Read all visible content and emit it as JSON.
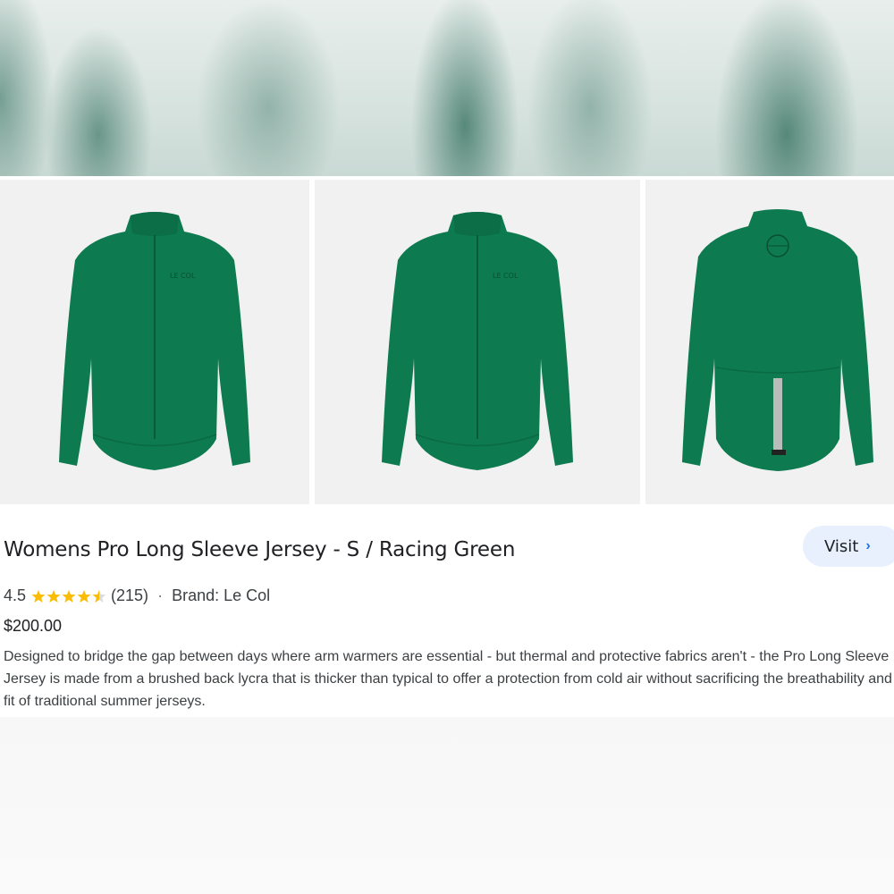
{
  "product": {
    "title": "Womens Pro Long Sleeve Jersey - S / Racing Green",
    "visit_label": "Visit",
    "rating": "4.5",
    "rating_value": 4.5,
    "review_count": "(215)",
    "brand": "Brand: Le Col",
    "price": "$200.00",
    "description": "Designed to bridge the gap between days where arm warmers are essential - but thermal and protective fabrics aren't - the Pro Long Sleeve Jersey is made from a brushed back lycra that is thicker than typical to offer a protection from cold air without sacrificing the breathability and fit of traditional summer jerseys.",
    "jersey_color": "#0d7a4f",
    "accent": "#1a73e8",
    "star_color": "#fbbc04"
  },
  "images": [
    {
      "icon": "jersey-front-icon"
    },
    {
      "icon": "jersey-front-icon"
    },
    {
      "icon": "jersey-back-icon"
    }
  ]
}
